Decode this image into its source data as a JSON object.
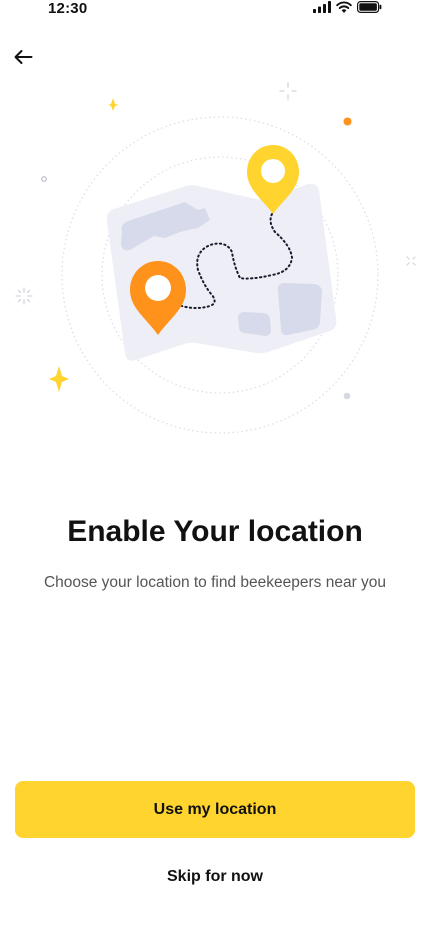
{
  "status_bar": {
    "time": "12:30",
    "icons": [
      "signal-icon",
      "wifi-icon",
      "battery-icon"
    ]
  },
  "header": {
    "back_icon": "arrow-left-icon"
  },
  "illustration": {
    "icon": "map-with-location-pins-icon",
    "colors": {
      "pin_yellow": "#FFD42F",
      "pin_orange": "#FF921A",
      "map": "#EEEFF6",
      "map_shapes": "#D7DAEA"
    }
  },
  "content": {
    "title": "Enable Your location",
    "subtitle": "Choose your location to find beekeepers near you"
  },
  "actions": {
    "primary_label": "Use my location",
    "skip_label": "Skip for now"
  },
  "colors": {
    "accent": "#FFD42F",
    "text": "#111111",
    "subtext": "#555555"
  }
}
